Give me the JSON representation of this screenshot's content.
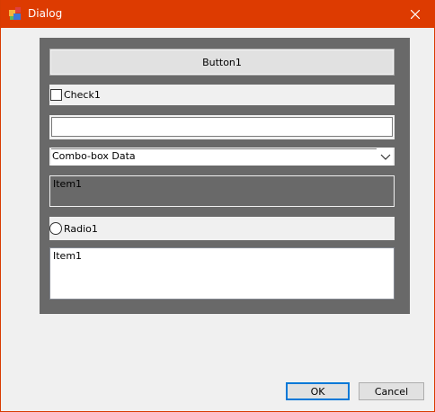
{
  "window": {
    "title": "Dialog"
  },
  "controls": {
    "button1_label": "Button1",
    "check1_label": "Check1",
    "edit_value": "",
    "combo_selected": "Combo-box Data",
    "list1_items": [
      "Item1"
    ],
    "radio1_label": "Radio1",
    "list2_items": [
      "Item1"
    ]
  },
  "footer": {
    "ok_label": "OK",
    "cancel_label": "Cancel"
  },
  "colors": {
    "titlebar": "#dd3b01",
    "panel": "#696969",
    "focus": "#0078d7"
  }
}
